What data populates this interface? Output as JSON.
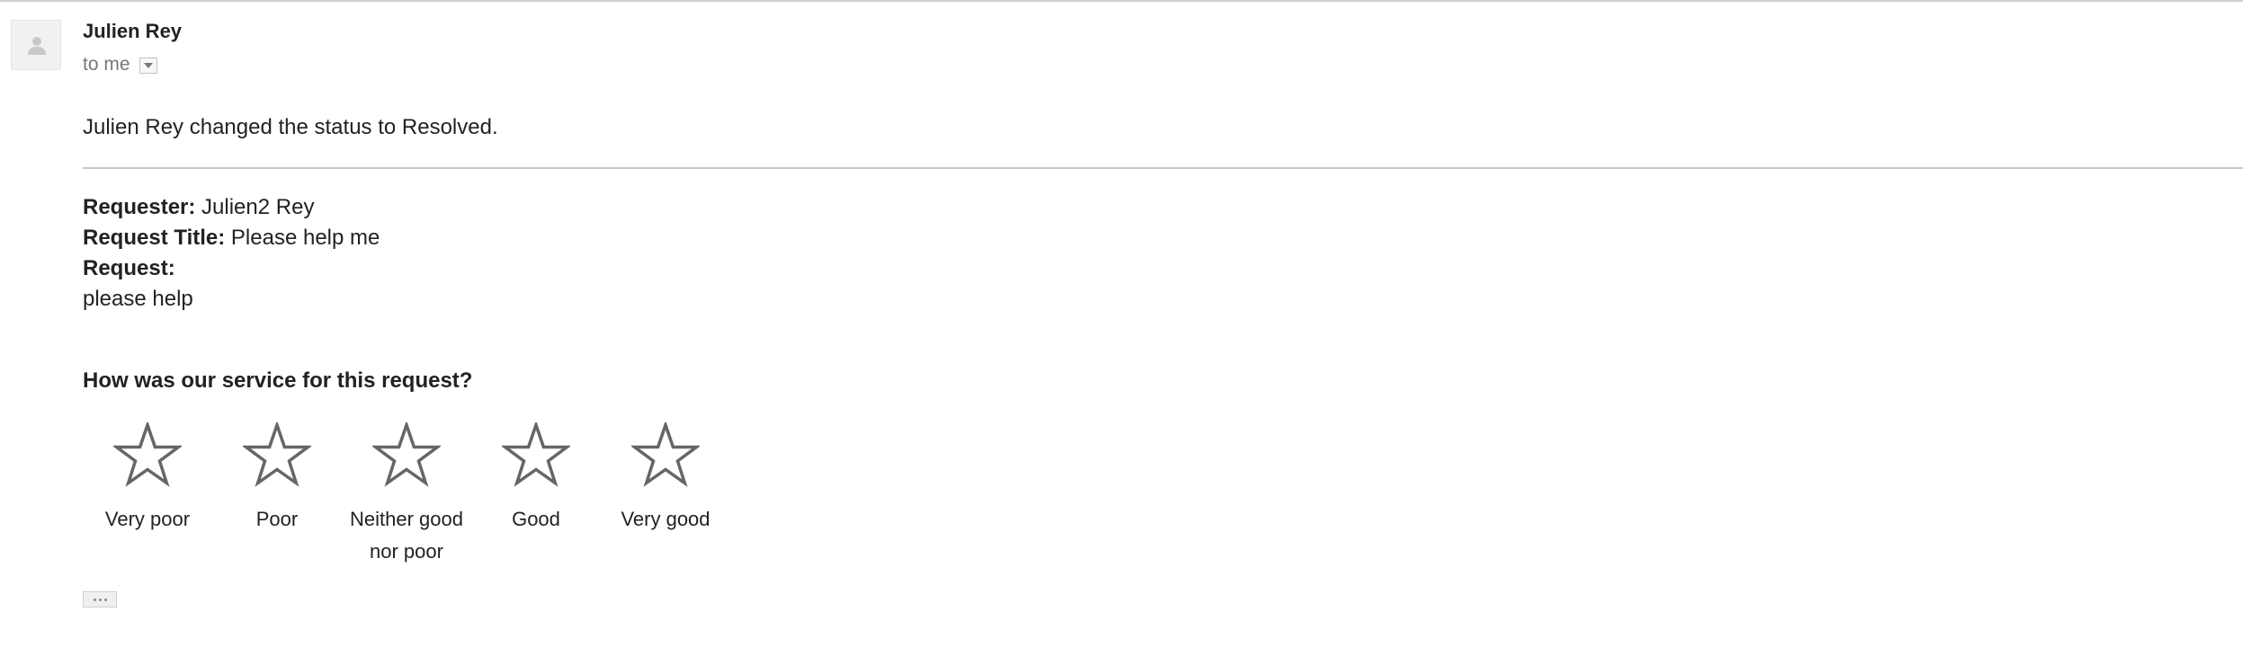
{
  "message": {
    "sender_name": "Julien Rey",
    "recipient_text": "to me",
    "status_line": "Julien Rey changed the status to Resolved."
  },
  "request": {
    "requester_label": "Requester:",
    "requester_value": "Julien2 Rey",
    "title_label": "Request Title:",
    "title_value": "Please help me",
    "request_label": "Request:",
    "request_body": "please help"
  },
  "rating": {
    "question": "How was our service for this request?",
    "options": [
      {
        "label": "Very poor",
        "icon": "star-outline-icon"
      },
      {
        "label": "Poor",
        "icon": "star-outline-icon"
      },
      {
        "label": "Neither good nor poor",
        "icon": "star-outline-icon"
      },
      {
        "label": "Good",
        "icon": "star-outline-icon"
      },
      {
        "label": "Very good",
        "icon": "star-outline-icon"
      }
    ]
  },
  "colors": {
    "star_stroke": "#666666",
    "text": "#222222",
    "muted_text": "#777777"
  }
}
